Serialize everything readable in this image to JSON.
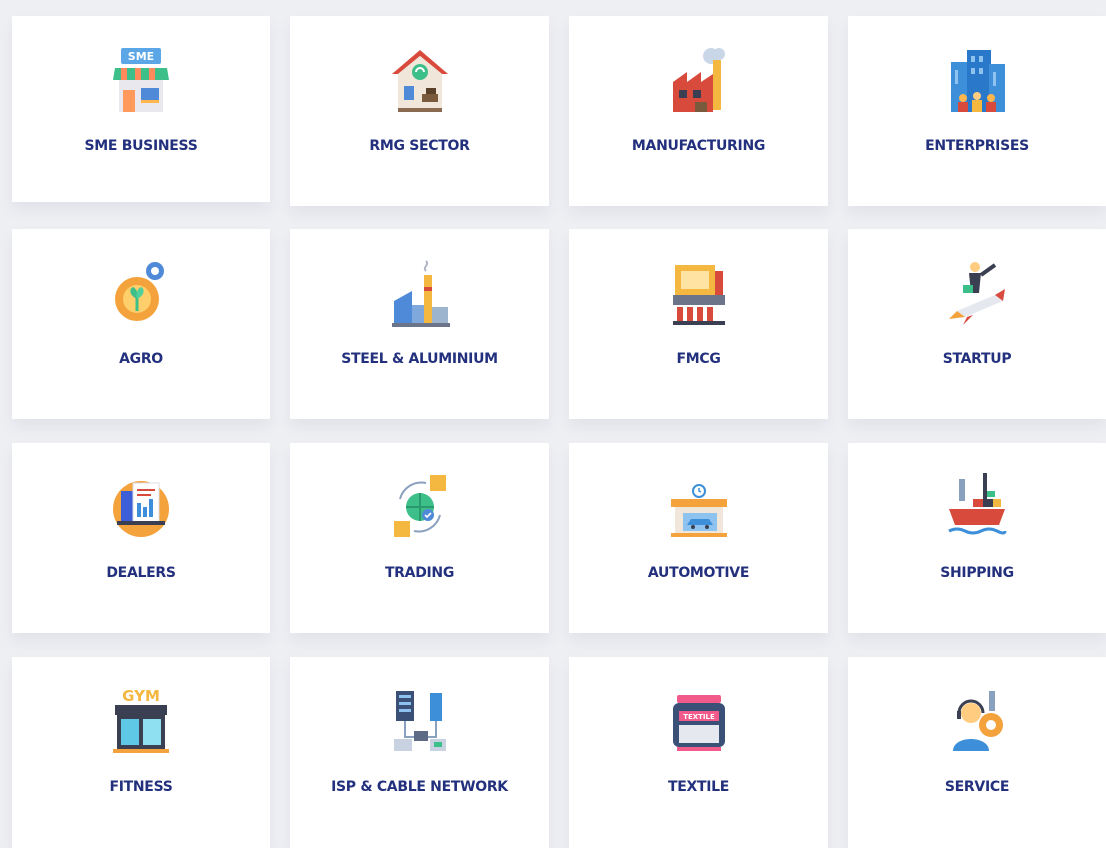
{
  "industries": [
    {
      "label": "SME BUSINESS",
      "icon": "sme-shop-icon"
    },
    {
      "label": "RMG SECTOR",
      "icon": "rmg-house-icon"
    },
    {
      "label": "MANUFACTURING",
      "icon": "factory-icon"
    },
    {
      "label": "ENTERPRISES",
      "icon": "enterprise-building-icon"
    },
    {
      "label": "AGRO",
      "icon": "agro-gear-plant-icon"
    },
    {
      "label": "STEEL & ALUMINIUM",
      "icon": "steel-mill-icon"
    },
    {
      "label": "FMCG",
      "icon": "fmcg-machine-icon"
    },
    {
      "label": "STARTUP",
      "icon": "rocket-man-icon"
    },
    {
      "label": "DEALERS",
      "icon": "dealer-chart-icon"
    },
    {
      "label": "TRADING",
      "icon": "globe-trade-icon"
    },
    {
      "label": "AUTOMOTIVE",
      "icon": "car-garage-icon"
    },
    {
      "label": "SHIPPING",
      "icon": "cargo-ship-icon"
    },
    {
      "label": "FITNESS",
      "icon": "gym-icon"
    },
    {
      "label": "ISP & CABLE NETWORK",
      "icon": "server-network-icon"
    },
    {
      "label": "TEXTILE",
      "icon": "textile-box-icon"
    },
    {
      "label": "SERVICE",
      "icon": "service-agent-icon"
    }
  ],
  "colors": {
    "label": "#23307d",
    "background": "#eeeff3",
    "card": "#ffffff"
  }
}
